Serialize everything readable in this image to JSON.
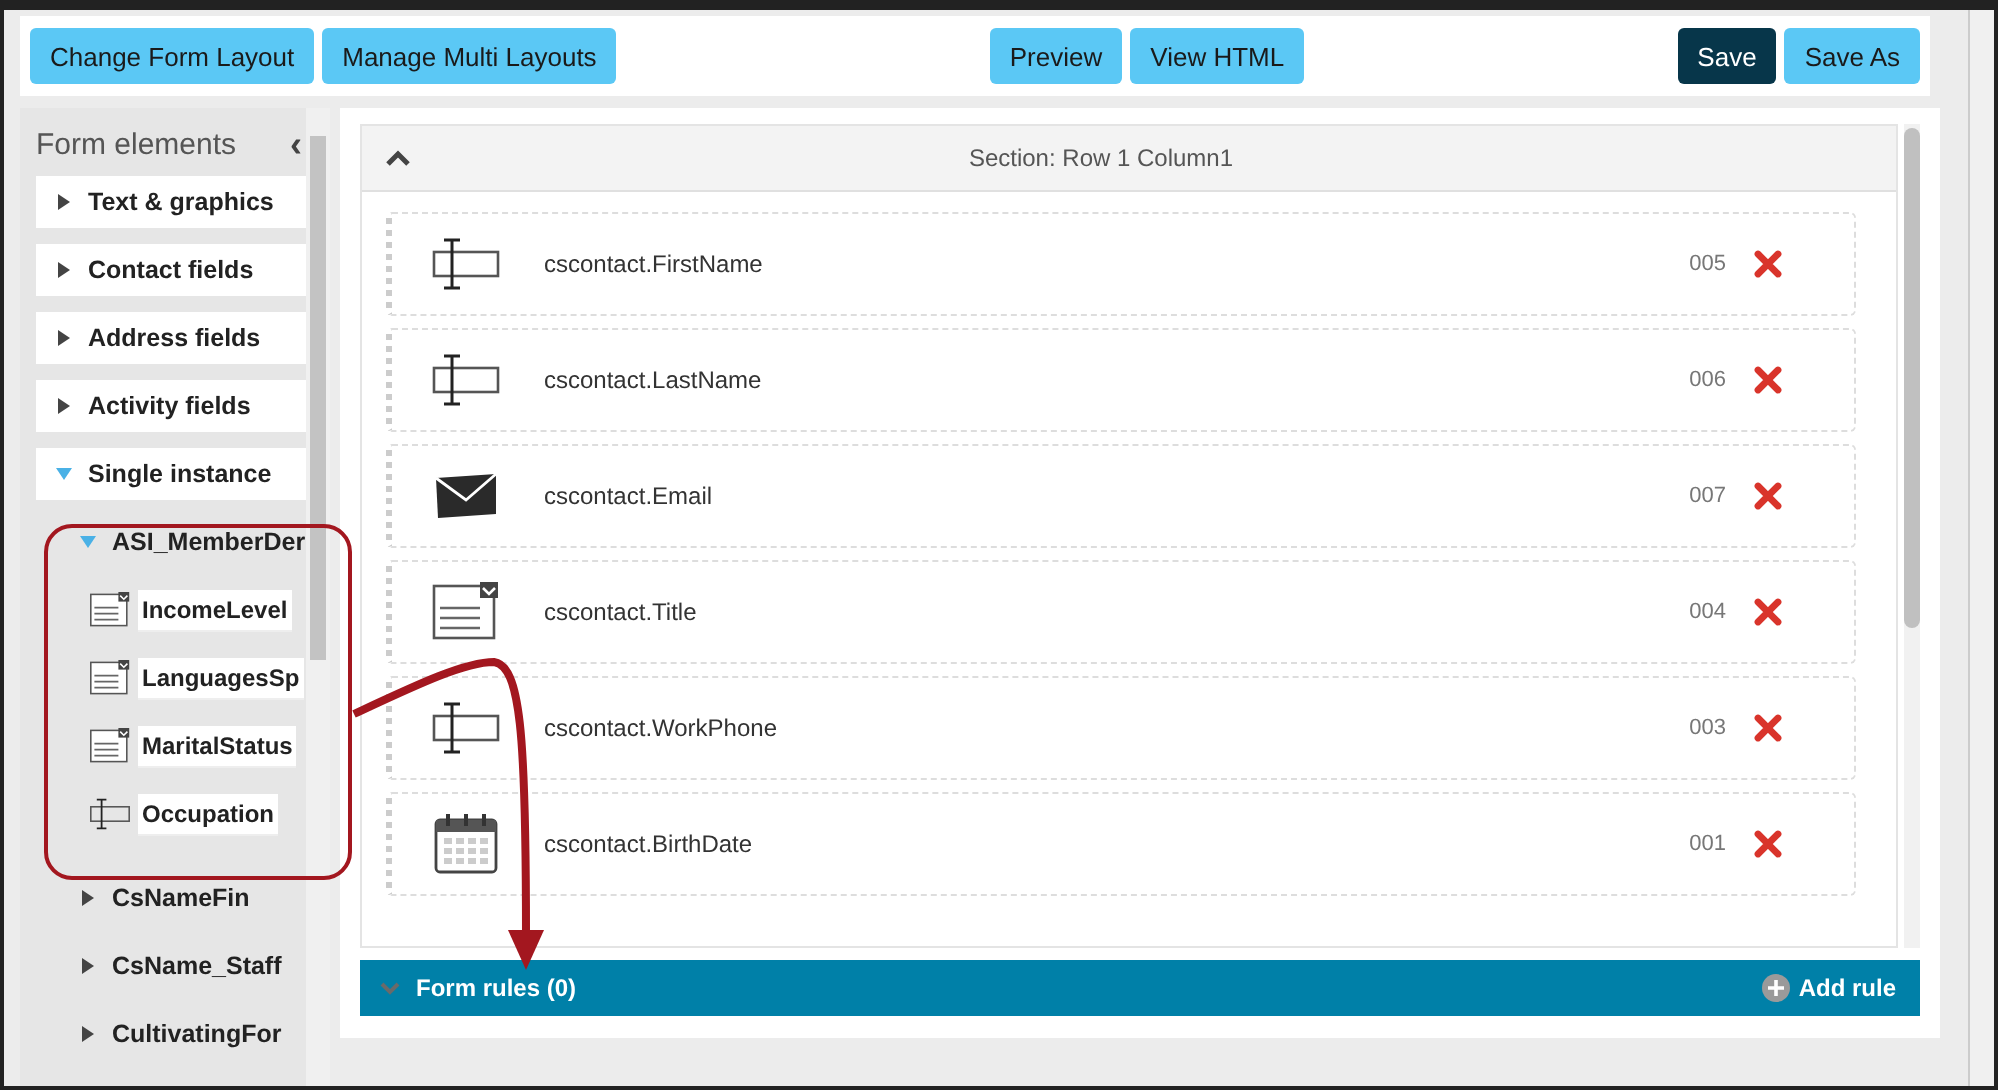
{
  "toolbar": {
    "left": [
      {
        "label": "Change Form Layout",
        "kind": "secondary"
      },
      {
        "label": "Manage Multi Layouts",
        "kind": "secondary"
      }
    ],
    "center": [
      {
        "label": "Preview",
        "kind": "secondary"
      },
      {
        "label": "View HTML",
        "kind": "secondary"
      }
    ],
    "right": [
      {
        "label": "Save",
        "kind": "primary"
      },
      {
        "label": "Save As",
        "kind": "secondary"
      }
    ]
  },
  "sidebar": {
    "title": "Form elements",
    "collapse_icon": "‹",
    "items": [
      {
        "label": "Text & graphics",
        "expanded": false
      },
      {
        "label": "Contact fields",
        "expanded": false
      },
      {
        "label": "Address fields",
        "expanded": false
      },
      {
        "label": "Activity fields",
        "expanded": false
      },
      {
        "label": "Single instance",
        "expanded": true,
        "children": [
          {
            "label": "ASI_MemberDer",
            "expanded": true,
            "children": [
              {
                "label": "IncomeLevel",
                "kind": "dropdown"
              },
              {
                "label": "LanguagesSp",
                "kind": "dropdown"
              },
              {
                "label": "MaritalStatus",
                "kind": "dropdown"
              },
              {
                "label": "Occupation",
                "kind": "text"
              }
            ]
          },
          {
            "label": "CsNameFin",
            "expanded": false
          },
          {
            "label": "CsName_Staff",
            "expanded": false
          },
          {
            "label": "CultivatingFor",
            "expanded": false
          }
        ]
      }
    ]
  },
  "section": {
    "title": "Section: Row 1 Column1",
    "expanded": true,
    "fields": [
      {
        "name": "cscontact.FirstName",
        "kind": "text",
        "number": "005"
      },
      {
        "name": "cscontact.LastName",
        "kind": "text",
        "number": "006"
      },
      {
        "name": "cscontact.Email",
        "kind": "email",
        "number": "007"
      },
      {
        "name": "cscontact.Title",
        "kind": "dropdown",
        "number": "004"
      },
      {
        "name": "cscontact.WorkPhone",
        "kind": "text",
        "number": "003"
      },
      {
        "name": "cscontact.BirthDate",
        "kind": "date",
        "number": "001"
      }
    ]
  },
  "form_rules": {
    "label": "Form rules (0)",
    "expanded": false,
    "add_label": "Add rule"
  }
}
